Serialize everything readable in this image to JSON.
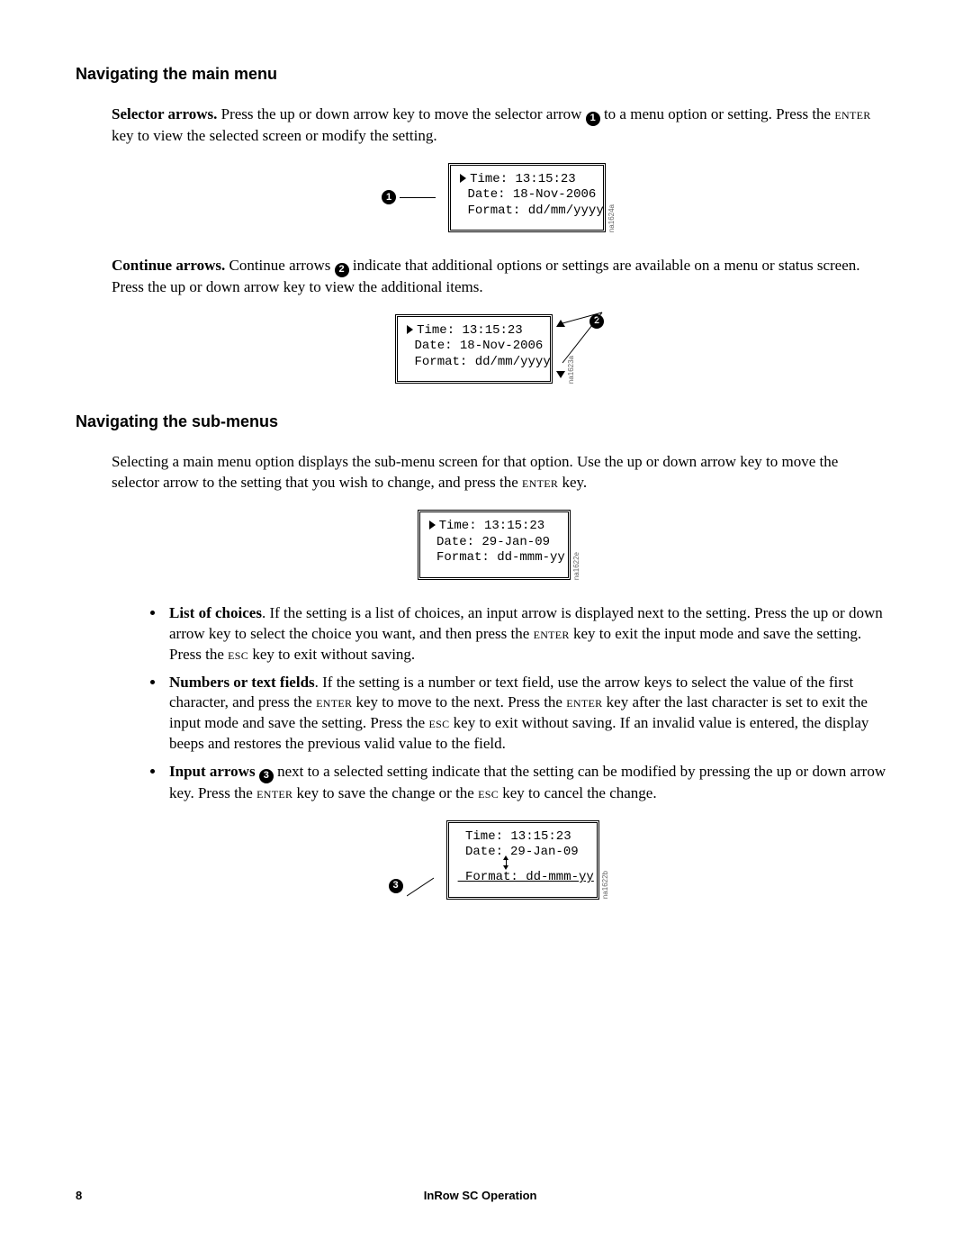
{
  "section1": {
    "heading": "Navigating the main menu",
    "para1_lead": "Selector arrows.",
    "para1_rest_a": " Press the up or down arrow key to move the selector arrow ",
    "para1_rest_b": " to a menu option or setting. Press the ",
    "para1_key1": "enter",
    "para1_rest_c": " key to view the selected screen or modify the setting.",
    "callout1": "1",
    "fig1": {
      "line1": "Time: 13:15:23",
      "line2": " Date: 18-Nov-2006",
      "line3": " Format: dd/mm/yyyy",
      "code": "na1624a"
    },
    "para2_lead": "Continue arrows.",
    "para2_a": " Continue arrows ",
    "callout2": "2",
    "para2_b": " indicate that additional options or settings are available on a menu or status screen. Press the up or down arrow key to view the additional items.",
    "fig2": {
      "line1": "Time: 13:15:23",
      "line2": " Date: 18-Nov-2006",
      "line3": " Format: dd/mm/yyyy",
      "code": "na1623a"
    }
  },
  "section2": {
    "heading": "Navigating the sub-menus",
    "para1_a": "Selecting a main menu option displays the sub-menu screen for that option. Use the up or down arrow key to move the selector arrow to the setting that you wish to change, and press the ",
    "para1_key": "enter",
    "para1_b": " key.",
    "fig3": {
      "line1": "Time: 13:15:23",
      "line2": " Date: 29-Jan-09",
      "line3": " Format: dd-mmm-yy",
      "code": "na1622e"
    },
    "bullets": {
      "b1_lead": "List of choices",
      "b1_a": ". If the setting is a list of choices, an input arrow is displayed next to the setting. Press the up or down arrow key to select the choice you want, and then press the ",
      "b1_key1": "enter",
      "b1_b": " key to exit the input mode and save the setting. Press the ",
      "b1_key2": "esc",
      "b1_c": " key to exit without saving.",
      "b2_lead": "Numbers or text fields",
      "b2_a": ". If the setting is a number or text field, use the arrow keys to select the value of the first character, and press the ",
      "b2_key1": "enter",
      "b2_b": " key to move to the next. Press the ",
      "b2_key2": "enter",
      "b2_c": " key after the last character is set to exit the input mode and save the setting. Press the ",
      "b2_key3": "esc",
      "b2_d": " key to exit without saving. If an invalid value is entered, the display beeps and restores the previous valid value to the field.",
      "b3_lead": "Input arrows ",
      "callout3": "3",
      "b3_a": " next to a selected setting indicate that the setting can be modified by pressing the up or down arrow key. Press the ",
      "b3_key1": "enter",
      "b3_b": " key to save the change or the ",
      "b3_key2": "esc",
      "b3_c": " key to cancel the change."
    },
    "fig4": {
      "line1": " Time: 13:15:23",
      "line2_a": " Date:",
      "line2_b": "29-Jan-09",
      "line3": " Format: dd-mmm-yy",
      "code": "na1622b"
    }
  },
  "footer": {
    "page": "8",
    "title": "InRow SC Operation"
  }
}
